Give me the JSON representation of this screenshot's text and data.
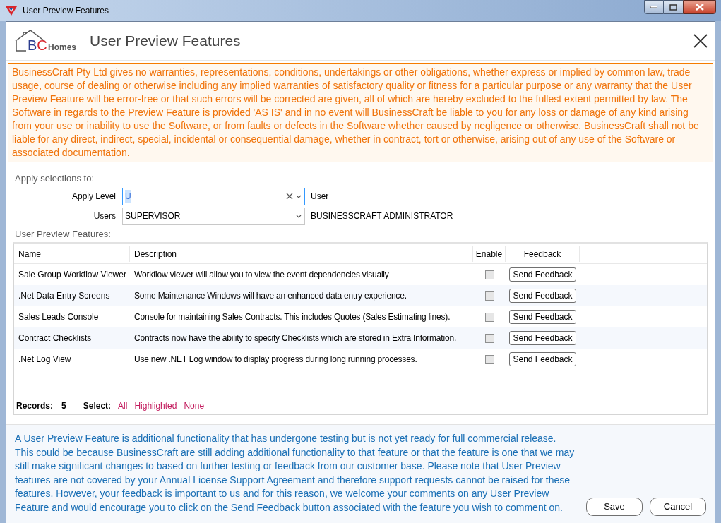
{
  "window": {
    "title": "User Preview Features"
  },
  "header": {
    "logo": {
      "letters": "BC",
      "word": "Homes"
    },
    "title": "User Preview Features"
  },
  "disclaimer": "BusinessCraft Pty Ltd gives no warranties, representations, conditions, undertakings or other obligations, whether express or implied by common law, trade usage, course of dealing or otherwise including any implied warranties of satisfactory quality or fitness for a particular purpose or any warranty that the User Preview Feature will be error-free or that such errors will be corrected are given, all of which are hereby excluded to the fullest extent permitted by law. The Software in regards to the Preview Feature is provided 'AS IS' and in no event will BusinessCraft be liable to you for any loss or damage of any kind arising from your use or inability to use the Software, or from faults or defects in the Software whether caused by negligence or otherwise. BusinessCraft shall not be liable for any direct, indirect, special, incidental or consequential damage, whether in contract, tort or otherwise, arising out of any use of the Software or associated documentation.",
  "apply": {
    "heading": "Apply selections to:",
    "fields": [
      {
        "label": "Apply Level",
        "value": "U",
        "description": "User",
        "focused": true,
        "clearable": true
      },
      {
        "label": "Users",
        "value": "SUPERVISOR",
        "description": "BUSINESSCRAFT ADMINISTRATOR",
        "focused": false,
        "clearable": false
      }
    ]
  },
  "table": {
    "heading": "User Preview Features:",
    "columns": [
      "Name",
      "Description",
      "Enable",
      "Feedback"
    ],
    "rows": [
      {
        "name": "Sale Group Workflow Viewer",
        "description": "Workflow viewer will allow you to view the event dependencies visually",
        "enabled": false,
        "button": "Send Feedback"
      },
      {
        "name": ".Net Data Entry Screens",
        "description": "Some Maintenance Windows will have an enhanced data entry experience.",
        "enabled": false,
        "button": "Send Feedback"
      },
      {
        "name": "Sales Leads Console",
        "description": "Console for maintaining Sales Contracts. This includes Quotes (Sales Estimating lines).",
        "enabled": false,
        "button": "Send Feedback"
      },
      {
        "name": "Contract Checklists",
        "description": "Contracts now have the ability to specify Checklists which are stored in Extra Information.",
        "enabled": false,
        "button": "Send Feedback"
      },
      {
        "name": ".Net Log View",
        "description": "Use new .NET Log window to display progress during long running processes.",
        "enabled": false,
        "button": "Send Feedback"
      }
    ],
    "footer": {
      "records_label": "Records:",
      "records_count": "5",
      "select_label": "Select:",
      "select_links": [
        "All",
        "Highlighted",
        "None"
      ]
    }
  },
  "info": "A User Preview Feature is additional functionality that has undergone testing but is not yet ready for full commercial release. This could be because BusinessCraft are still adding additional functionality to that feature or that the feature is one that we may still make significant changes to based on further testing or feedback from our customer base. Please note that User Preview features are not covered by your Annual License Support Agreement and therefore support requests cannot be raised for these features. However, your feedback is important to us and for this reason, we welcome your comments on any User Preview Feature and would encourage you to click on the Send Feedback button associated with the feature you wish to comment on.",
  "buttons": [
    "Save",
    "Cancel"
  ]
}
